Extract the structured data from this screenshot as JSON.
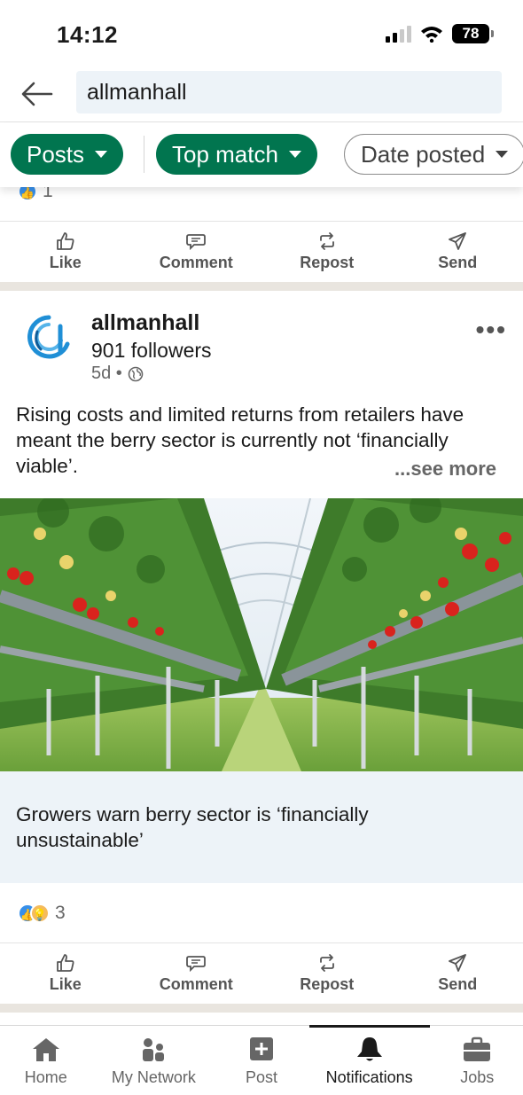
{
  "status_bar": {
    "time": "14:12",
    "battery": "78"
  },
  "search": {
    "query": "allmanhall"
  },
  "filters": [
    {
      "label": "Posts",
      "selected": true
    },
    {
      "label": "Top match",
      "selected": true
    },
    {
      "label": "Date posted",
      "selected": false
    }
  ],
  "prev_post": {
    "reaction_count": "1"
  },
  "actions": {
    "like": "Like",
    "comment": "Comment",
    "repost": "Repost",
    "send": "Send"
  },
  "post": {
    "author": "allmanhall",
    "followers": "901 followers",
    "age": "5d •",
    "text": "Rising costs and limited returns from retailers have meant the berry sector is currently not ‘financially viable’.",
    "see_more": "...see more",
    "article_title": "Growers warn berry sector is ‘financially unsustainable’",
    "reaction_count": "3"
  },
  "bottom_nav": [
    {
      "label": "Home",
      "icon": "home-icon"
    },
    {
      "label": "My Network",
      "icon": "network-icon"
    },
    {
      "label": "Post",
      "icon": "post-icon"
    },
    {
      "label": "Notifications",
      "icon": "bell-icon",
      "active": true
    },
    {
      "label": "Jobs",
      "icon": "briefcase-icon"
    }
  ],
  "colors": {
    "accent_green": "#01754f",
    "search_bg": "#edf3f8",
    "like_blue": "#378fe9"
  }
}
